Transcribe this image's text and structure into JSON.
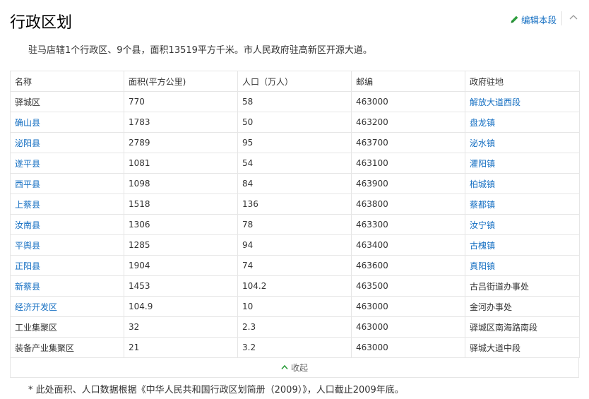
{
  "section": {
    "title": "行政区划",
    "edit_label": "编辑本段",
    "intro": "驻马店辖1个行政区、9个县，面积13519平方千米。市人民政府驻高新区开源大道。"
  },
  "table": {
    "headers": [
      "名称",
      "面积(平方公里)",
      "人口（万人）",
      "邮编",
      "政府驻地"
    ],
    "rows": [
      {
        "name": "驿城区",
        "area": "770",
        "pop": "58",
        "zip": "463000",
        "seat": "解放大道西段",
        "name_link": false,
        "seat_link": true
      },
      {
        "name": "确山县",
        "area": "1783",
        "pop": "50",
        "zip": "463200",
        "seat": "盘龙镇",
        "name_link": true,
        "seat_link": true
      },
      {
        "name": "泌阳县",
        "area": "2789",
        "pop": "95",
        "zip": "463700",
        "seat": "泌水镇",
        "name_link": true,
        "seat_link": true
      },
      {
        "name": "遂平县",
        "area": "1081",
        "pop": "54",
        "zip": "463100",
        "seat": "灈阳镇",
        "name_link": true,
        "seat_link": true
      },
      {
        "name": "西平县",
        "area": "1098",
        "pop": "84",
        "zip": "463900",
        "seat": "柏城镇",
        "name_link": true,
        "seat_link": true
      },
      {
        "name": "上蔡县",
        "area": "1518",
        "pop": "136",
        "zip": "463800",
        "seat": "蔡都镇",
        "name_link": true,
        "seat_link": true
      },
      {
        "name": "汝南县",
        "area": "1306",
        "pop": "78",
        "zip": "463300",
        "seat": "汝宁镇",
        "name_link": true,
        "seat_link": true
      },
      {
        "name": "平舆县",
        "area": "1285",
        "pop": "94",
        "zip": "463400",
        "seat": "古槐镇",
        "name_link": true,
        "seat_link": true
      },
      {
        "name": "正阳县",
        "area": "1904",
        "pop": "74",
        "zip": "463600",
        "seat": "真阳镇",
        "name_link": true,
        "seat_link": true
      },
      {
        "name": "新蔡县",
        "area": "1453",
        "pop": "104.2",
        "zip": "463500",
        "seat": "古吕街道办事处",
        "name_link": true,
        "seat_link": false
      },
      {
        "name": "经济开发区",
        "area": "104.9",
        "pop": "10",
        "zip": "463000",
        "seat": "金河办事处",
        "name_link": true,
        "seat_link": false
      },
      {
        "name": "工业集聚区",
        "area": "32",
        "pop": "2.3",
        "zip": "463000",
        "seat": "驿城区南海路南段",
        "name_link": false,
        "seat_link": false
      },
      {
        "name": "装备产业集聚区",
        "area": "21",
        "pop": "3.2",
        "zip": "463000",
        "seat": "驿城大道中段",
        "name_link": false,
        "seat_link": false
      }
    ],
    "collapse_label": "收起"
  },
  "footnote": "* 此处面积、人口数据根据《中华人民共和国行政区划简册（2009）》，人口截止2009年底。",
  "colors": {
    "link": "#136ec2",
    "border": "#e6e6e6",
    "edit_icon": "#2e9e3e"
  }
}
